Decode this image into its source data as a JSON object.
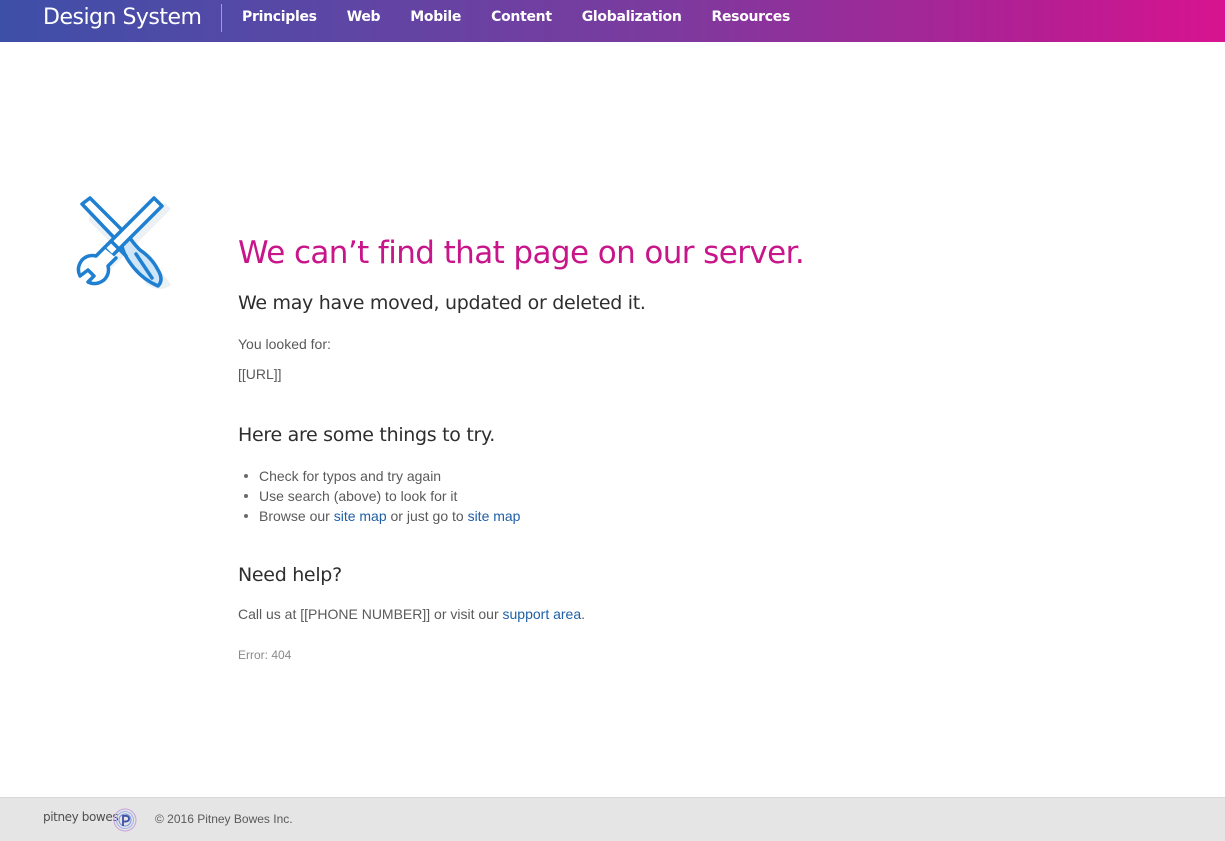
{
  "header": {
    "brand": "Design System",
    "nav": [
      "Principles",
      "Web",
      "Mobile",
      "Content",
      "Globalization",
      "Resources"
    ]
  },
  "illustration": {
    "icon": "crossed-wrench-screwdriver-icon",
    "color": "#1f7fd0"
  },
  "main": {
    "headline": "We can’t find that page on our server.",
    "subhead": "We may have moved, updated or deleted it.",
    "looked_for_label": "You looked for:",
    "url_value": "[[URL]]",
    "tries_title": "Here are some things to try.",
    "tries": {
      "item1": "Check for typos and try again",
      "item2": "Use search (above) to look for it",
      "item3_prefix": "Browse our ",
      "item3_link1": "site map",
      "item3_middle": " or just go to ",
      "item3_link2": "site map"
    },
    "help_title": "Need help?",
    "help": {
      "prefix": "Call us at [[PHONE NUMBER]] or visit our ",
      "link": "support area",
      "suffix": "."
    },
    "error_code": "Error: 404"
  },
  "footer": {
    "logo_text": "pitney bowes",
    "copyright": "© 2016 Pitney Bowes Inc."
  },
  "colors": {
    "accent": "#c8158a",
    "link": "#1f5fa6",
    "nav_gradient_start": "#3e4fa8",
    "nav_gradient_end": "#d8138f"
  }
}
